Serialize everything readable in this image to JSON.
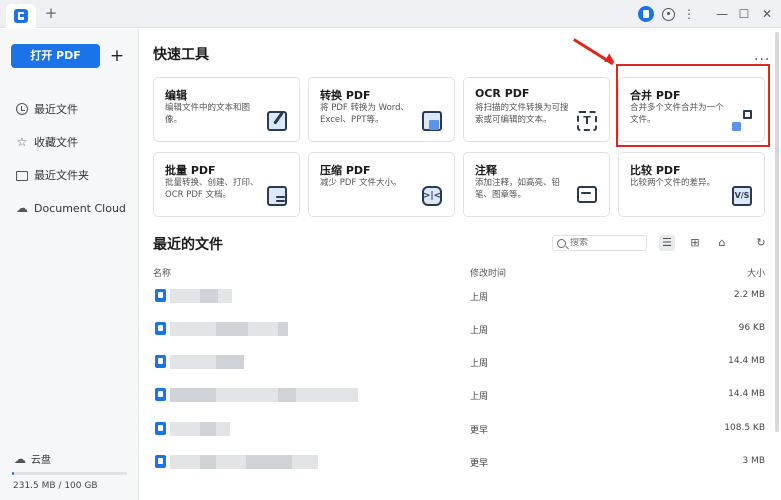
{
  "titlebar": {
    "new_tab": "+",
    "more": "⋮",
    "minimize": "—",
    "maximize": "☐",
    "close": "✕"
  },
  "sidebar": {
    "open_button": "打开 PDF",
    "add_button": "+",
    "items": [
      {
        "label": "最近文件",
        "icon": "clock-icon"
      },
      {
        "label": "收藏文件",
        "icon": "star-icon"
      },
      {
        "label": "最近文件夹",
        "icon": "folder-icon"
      },
      {
        "label": "Document Cloud",
        "icon": "cloud-icon"
      }
    ],
    "cloud_label": "云盘",
    "storage": "231.5 MB / 100 GB",
    "storage_fraction": 0.0023
  },
  "quick_tools": {
    "title": "快速工具",
    "more": "...",
    "cards": [
      {
        "title": "编辑",
        "desc": "编辑文件中的文本和图像。",
        "icon": "edit-icon"
      },
      {
        "title": "转换 PDF",
        "desc": "将 PDF 转换为 Word、Excel、PPT等。",
        "icon": "convert-icon"
      },
      {
        "title": "OCR PDF",
        "desc": "将扫描的文件转换为可搜索或可编辑的文本。",
        "icon": "ocr-icon",
        "glyph": "T"
      },
      {
        "title": "合并 PDF",
        "desc": "合并多个文件合并为一个文件。",
        "icon": "merge-icon"
      },
      {
        "title": "批量 PDF",
        "desc": "批量转换、创建、打印、OCR PDF 文档。",
        "icon": "batch-icon"
      },
      {
        "title": "压缩 PDF",
        "desc": "减少 PDF 文件大小。",
        "icon": "compress-icon"
      },
      {
        "title": "注释",
        "desc": "添加注释，如高亮、铅笔、图章等。",
        "icon": "comment-icon"
      },
      {
        "title": "比较 PDF",
        "desc": "比较两个文件的差异。",
        "icon": "compare-icon",
        "glyph": "V/S"
      }
    ]
  },
  "recent": {
    "title": "最近的文件",
    "search_placeholder": "搜索",
    "columns": {
      "name": "名称",
      "modified": "修改时间",
      "size": "大小"
    },
    "rows": [
      {
        "modified": "上周",
        "size": "2.2 MB"
      },
      {
        "modified": "上周",
        "size": "96 KB"
      },
      {
        "modified": "上周",
        "size": "14.4 MB"
      },
      {
        "modified": "上周",
        "size": "14.4 MB"
      },
      {
        "modified": "更早",
        "size": "108.5 KB"
      },
      {
        "modified": "更早",
        "size": "3 MB"
      }
    ]
  },
  "colors": {
    "accent": "#1a73e8",
    "highlight": "#e0251b"
  }
}
